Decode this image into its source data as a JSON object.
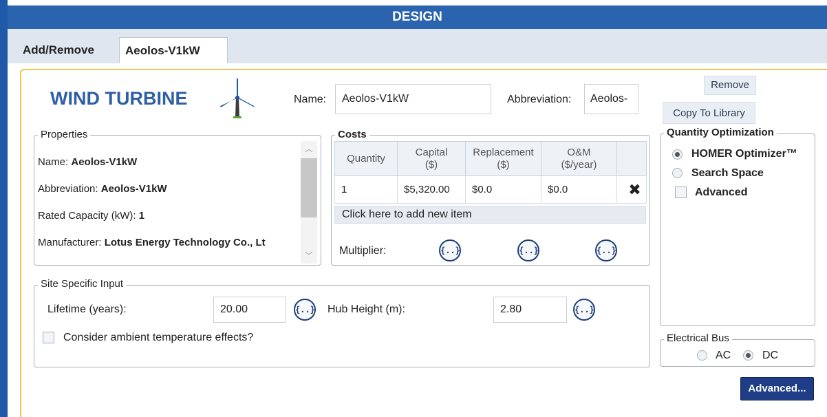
{
  "window": {
    "title": "DESIGN"
  },
  "tabs": [
    {
      "label": "Add/Remove",
      "active": false
    },
    {
      "label": "Aeolos-V1kW",
      "active": true
    }
  ],
  "component": {
    "heading": "WIND TURBINE",
    "icon": "wind-turbine-icon",
    "name_label": "Name:",
    "name_value": "Aeolos-V1kW",
    "abbr_label": "Abbreviation:",
    "abbr_value": "Aeolos-",
    "remove_label": "Remove",
    "copy_label": "Copy To Library"
  },
  "properties": {
    "title": "Properties",
    "items": [
      {
        "key": "Name:",
        "value": "Aeolos-V1kW"
      },
      {
        "key": "Abbreviation:",
        "value": "Aeolos-V1kW"
      },
      {
        "key": "Rated Capacity (kW):",
        "value": "1"
      },
      {
        "key": "Manufacturer:",
        "value": "Lotus Energy Technology Co., Lt"
      }
    ]
  },
  "costs": {
    "title": "Costs",
    "headers": [
      {
        "line1": "Quantity",
        "line2": ""
      },
      {
        "line1": "Capital",
        "line2": "($)"
      },
      {
        "line1": "Replacement",
        "line2": "($)"
      },
      {
        "line1": "O&M",
        "line2": "($/year)"
      }
    ],
    "rows": [
      {
        "quantity": "1",
        "capital": "$5,320.00",
        "replacement": "$0.0",
        "om": "$0.0"
      }
    ],
    "add_item": "Click here to add new item",
    "multiplier_label": "Multiplier:",
    "multiplier_button": "{..}"
  },
  "site_input": {
    "title": "Site Specific Input",
    "lifetime_label": "Lifetime (years):",
    "lifetime_value": "20.00",
    "hub_label": "Hub Height (m):",
    "hub_value": "2.80",
    "ambient_label": "Consider ambient temperature effects?",
    "ambient_checked": false
  },
  "quantity_optimization": {
    "title": "Quantity Optimization",
    "options": [
      {
        "label": "HOMER Optimizer™",
        "selected": true
      },
      {
        "label": "Search Space",
        "selected": false
      }
    ],
    "advanced_label": "Advanced",
    "advanced_checked": false
  },
  "electrical_bus": {
    "title": "Electrical Bus",
    "options": [
      {
        "label": "AC",
        "selected": false
      },
      {
        "label": "DC",
        "selected": true
      }
    ]
  },
  "advanced_button": "Advanced..."
}
